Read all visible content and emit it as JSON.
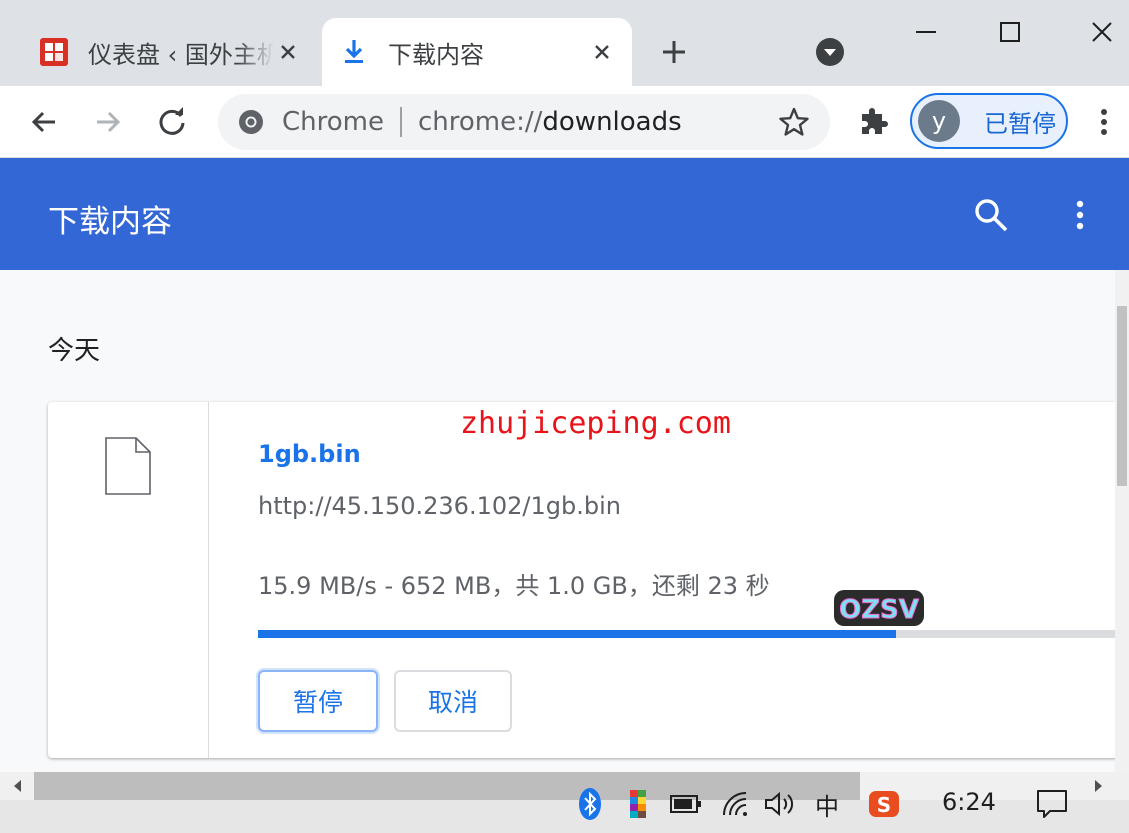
{
  "tabs": [
    {
      "title": "仪表盘 ‹ 国外主机",
      "active": false
    },
    {
      "title": "下载内容",
      "active": true
    }
  ],
  "omnibox": {
    "chip": "Chrome",
    "url_scheme": "chrome://",
    "url_host": "downloads"
  },
  "profile": {
    "initial": "y",
    "label": "已暂停"
  },
  "page": {
    "title": "下载内容",
    "section": "今天"
  },
  "download": {
    "watermark": "zhujiceping.com",
    "file_name": "1gb.bin",
    "url": "http://45.150.236.102/1gb.bin",
    "status": "15.9 MB/s - 652 MB，共 1.0 GB，还剩 23 秒",
    "progress_fraction": 0.733,
    "pause_label": "暂停",
    "cancel_label": "取消"
  },
  "taskbar": {
    "ime": "中",
    "clock": "6:24"
  },
  "colors": {
    "header_blue": "#3367d6",
    "accent_blue": "#1a73e8",
    "watermark_red": "#e8141a"
  }
}
